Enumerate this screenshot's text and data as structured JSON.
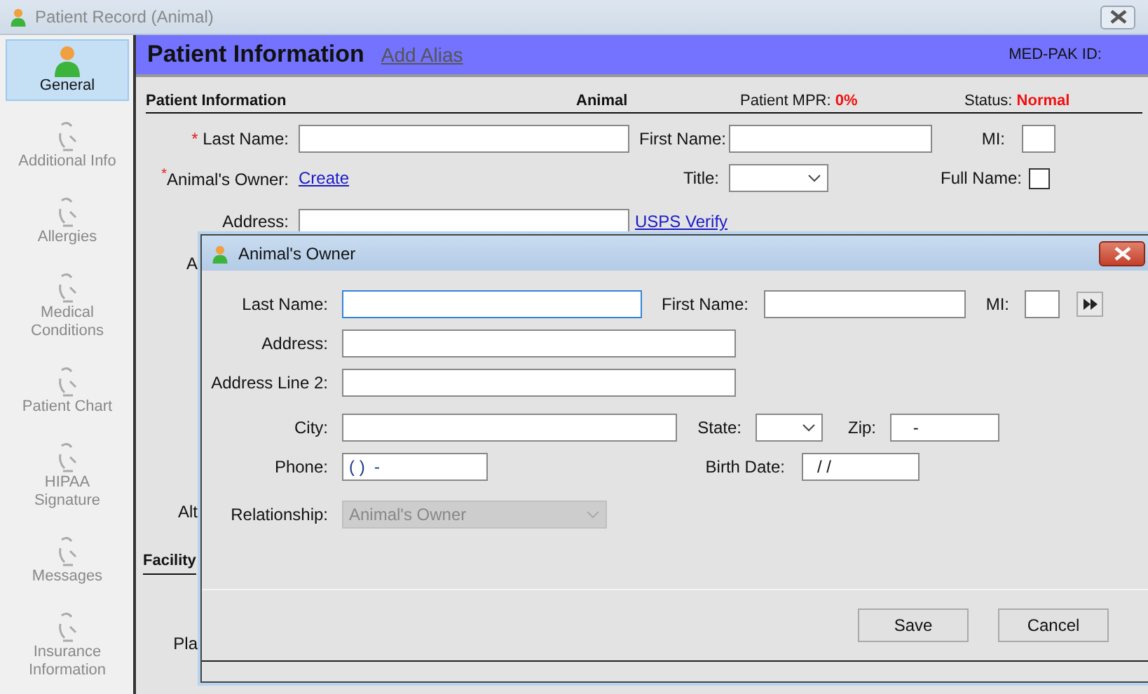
{
  "window": {
    "title": "Patient Record (Animal)"
  },
  "sidebar": {
    "items": [
      {
        "label": "General",
        "selected": true
      },
      {
        "label": "Additional Info",
        "selected": false
      },
      {
        "label": "Allergies",
        "selected": false
      },
      {
        "label": "Medical Conditions",
        "selected": false
      },
      {
        "label": "Patient Chart",
        "selected": false
      },
      {
        "label": "HIPAA Signature",
        "selected": false
      },
      {
        "label": "Messages",
        "selected": false
      },
      {
        "label": "Insurance Information",
        "selected": false
      }
    ]
  },
  "header": {
    "title": "Patient Information",
    "link": "Add Alias",
    "id_label": "MED-PAK ID:"
  },
  "section": {
    "title": "Patient Information",
    "type": "Animal",
    "mpr_label": "Patient MPR:",
    "mpr_value": "0%",
    "status_label": "Status:",
    "status_value": "Normal"
  },
  "patient_form": {
    "last_name": {
      "mark": "*",
      "label": "Last Name:"
    },
    "first_name": {
      "label": "First Name:"
    },
    "mi": {
      "label": "MI:"
    },
    "owner": {
      "mark": "*",
      "label": "Animal's Owner:",
      "link": "Create"
    },
    "title": {
      "label": "Title:"
    },
    "full_name": {
      "label": "Full Name:",
      "checked": false
    },
    "address": {
      "label": "Address:",
      "link": "USPS Verify"
    },
    "fragments": [
      "A",
      "Alt"
    ],
    "facility_heading": "Facility",
    "fragment_below": "Pla"
  },
  "dialog": {
    "title": "Animal's Owner",
    "last_name": {
      "label": "Last Name:",
      "focused": true
    },
    "first_name": {
      "label": "First Name:"
    },
    "mi": {
      "label": "MI:"
    },
    "address": {
      "label": "Address:"
    },
    "address2": {
      "label": "Address Line 2:"
    },
    "city": {
      "label": "City:"
    },
    "state": {
      "label": "State:"
    },
    "zip": {
      "label": "Zip:",
      "value": " -"
    },
    "phone": {
      "label": "Phone:",
      "value": "( )  -"
    },
    "birth_date": {
      "label": "Birth Date:",
      "value": "/ /"
    },
    "relationship": {
      "label": "Relationship:",
      "value": "Animal's Owner",
      "disabled": true
    },
    "buttons": [
      {
        "label": "Save"
      },
      {
        "label": "Cancel"
      }
    ]
  }
}
